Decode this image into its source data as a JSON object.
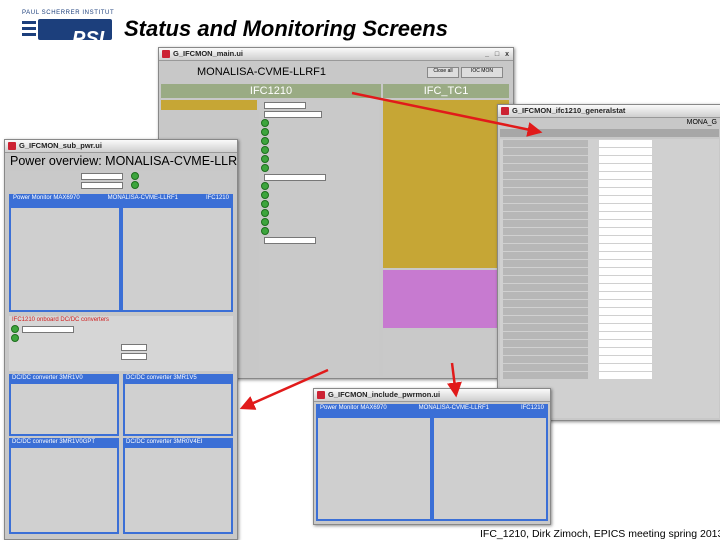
{
  "header": {
    "logo_small_text": "PAUL SCHERRER INSTITUT",
    "logo_text": "PSI",
    "slide_title": "Status and Monitoring Screens"
  },
  "footer": {
    "text": "IFC_1210, Dirk Zimoch, EPICS meeting spring 2013"
  },
  "colors": {
    "arrow": "#e11a1a",
    "title_blue": "#1c3f7c",
    "panel_olive": "#c6a635",
    "panel_purple": "#c77ad0",
    "panel_blue": "#3b6fd6"
  },
  "main_window": {
    "title": "G_IFCMON_main.ui",
    "device": "MONALISA-CVME-LLRF1",
    "left_header": "IFC1210",
    "right_header": "IFC_TC1",
    "btn_a": "Close all",
    "btn_b": "IOC MON"
  },
  "general_window": {
    "title": "G_IFCMON_ifc1210_generalstat",
    "device": "MONA_G"
  },
  "power_window": {
    "title": "G_IFCMON_sub_pwr.ui",
    "heading": "Power overview: MONALISA-CVME-LLRF",
    "pm_label": "Power Monitor MAX6970",
    "pm_device": "MONALISA-CVME-LLRF1",
    "pm_ifc": "IFC1210",
    "dcdc_header": "IFC1210 onboard DC/DC converters",
    "conv1": "DC/DC converter 3MR1V0",
    "conv2": "DC/DC converter 3MR1V5",
    "conv3": "DC/DC converter 3MR1V0GPT",
    "conv4": "DC/DC converter 3MR0V4EI"
  },
  "include_window": {
    "title": "G_IFCMON_include_pwrmon.ui",
    "pm_label": "Power Monitor MAX6970",
    "pm_device": "MONALISA-CVME-LLRF1",
    "pm_ifc": "IFC1210"
  }
}
